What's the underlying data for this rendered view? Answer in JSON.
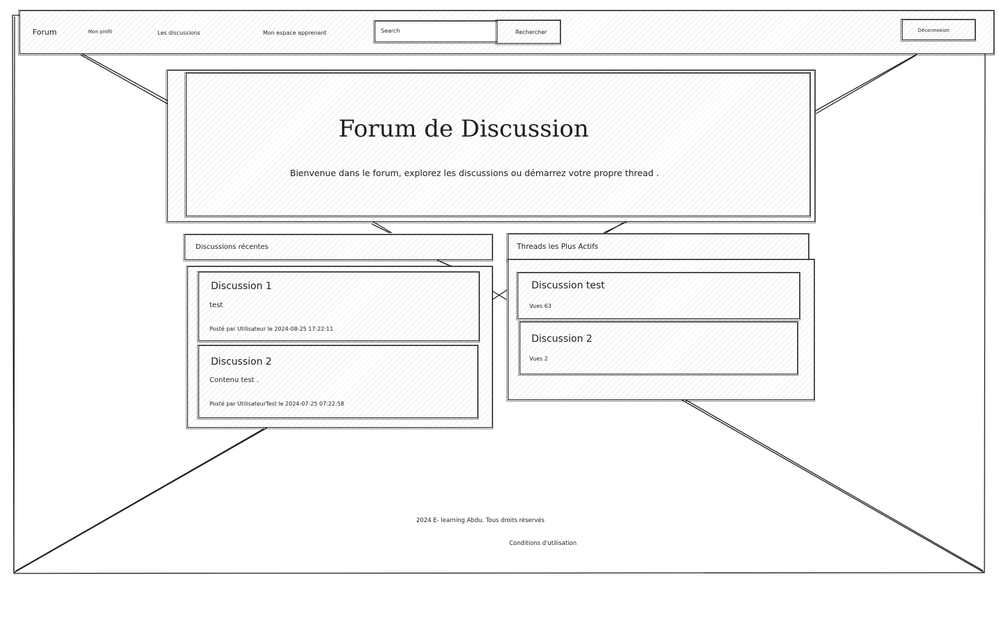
{
  "nav": {
    "brand": "Forum",
    "links": [
      "Mon profil",
      "Les discussions",
      "Mon espace apprenant"
    ],
    "search_placeholder": "Search",
    "search_button": "Rechercher",
    "logout_button": "Déconnexion"
  },
  "hero": {
    "title": "Forum de Discussion",
    "subtitle": "Bienvenue dans le forum, explorez les discussions ou démarrez votre propre thread ."
  },
  "recent": {
    "heading": "Discussions récentes",
    "items": [
      {
        "title": "Discussion 1",
        "content": "test",
        "meta": "Posté par Utilisateur le 2024-08-25 17:22:11"
      },
      {
        "title": "Discussion 2",
        "content": "Contenu test .",
        "meta": "Posté par UtilisateurTest le 2024-07-25 07:22:58"
      }
    ]
  },
  "active": {
    "heading": "Threads les Plus Actifs",
    "items": [
      {
        "title": "Discussion test",
        "views": "Vues 63"
      },
      {
        "title": "Discussion 2",
        "views": "Vues 2"
      }
    ]
  },
  "footer": {
    "copyright": "2024 E- learning Abdu. Tous droits réservés",
    "terms_link": "Conditions d'utilisation"
  }
}
